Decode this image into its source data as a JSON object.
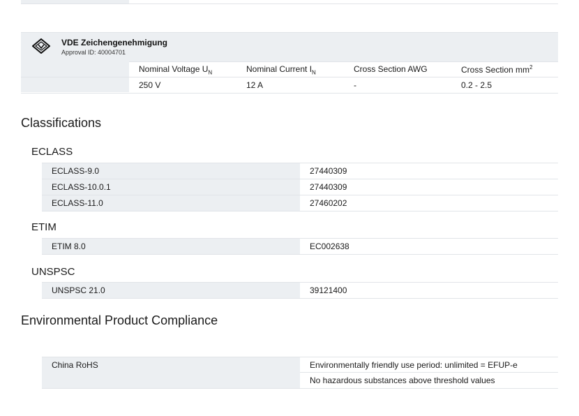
{
  "approval": {
    "title": "VDE Zeichengenehmigung",
    "approval_id": "Approval ID: 40004701",
    "icon": "vde-mark-icon",
    "columns": [
      {
        "label": "Nominal Voltage U",
        "mark": "N",
        "mark_type": "sub"
      },
      {
        "label": "Nominal Current I",
        "mark": "N",
        "mark_type": "sub"
      },
      {
        "label": "Cross Section AWG",
        "mark": "",
        "mark_type": ""
      },
      {
        "label": "Cross Section mm",
        "mark": "2",
        "mark_type": "sup"
      }
    ],
    "values": [
      "250 V",
      "12 A",
      "-",
      "0.2 - 2.5"
    ]
  },
  "classifications": {
    "heading": "Classifications",
    "eclass": {
      "heading": "ECLASS",
      "rows": [
        {
          "key": "ECLASS-9.0",
          "value": "27440309"
        },
        {
          "key": "ECLASS-10.0.1",
          "value": "27440309"
        },
        {
          "key": "ECLASS-11.0",
          "value": "27460202"
        }
      ]
    },
    "etim": {
      "heading": "ETIM",
      "rows": [
        {
          "key": "ETIM 8.0",
          "value": "EC002638"
        }
      ]
    },
    "unspsc": {
      "heading": "UNSPSC",
      "rows": [
        {
          "key": "UNSPSC 21.0",
          "value": "39121400"
        }
      ]
    }
  },
  "compliance": {
    "heading": "Environmental Product Compliance",
    "key": "China RoHS",
    "values": [
      "Environmentally friendly use period: unlimited = EFUP-e",
      "No hazardous substances above threshold values"
    ]
  }
}
